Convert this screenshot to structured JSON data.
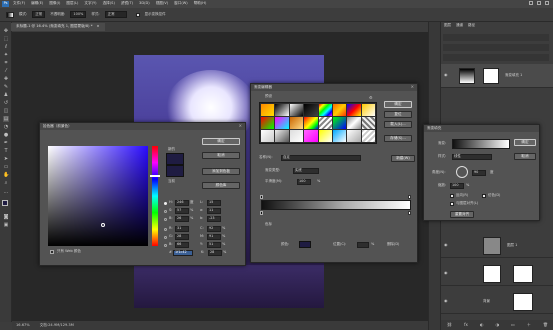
{
  "menu": {
    "items": [
      "文件(F)",
      "编辑(E)",
      "图像(I)",
      "图层(L)",
      "文字(Y)",
      "选择(S)",
      "滤镜(T)",
      "3D(D)",
      "视图(V)",
      "窗口(W)",
      "帮助(H)"
    ]
  },
  "options": {
    "mode_label": "模式:",
    "mode_value": "正常",
    "opacity_label": "不透明度:",
    "opacity_value": "100%",
    "style_label": "样式:",
    "style_value": "正常",
    "blend_label": "模式:",
    "checkbox_label": "显示变换控件"
  },
  "document": {
    "tab": "未标题-1 @ 16.4% (渐变填充 1, 图层蒙版/8) *"
  },
  "status": {
    "zoom": "16.67%",
    "doc": "文档:24.9M/129.3M"
  },
  "color_picker": {
    "title": "拾色器（前景色）",
    "ok": "确定",
    "cancel": "取消",
    "add_swatch": "添加到色板",
    "libraries": "颜色库",
    "new_label": "新的",
    "current_label": "当前",
    "web_only": "只有 Web 颜色",
    "fields": [
      {
        "k": "H:",
        "v": "246",
        "u": "度",
        "k2": "L:",
        "v2": "15"
      },
      {
        "k": "S:",
        "v": "57",
        "u": "%",
        "k2": "a:",
        "v2": "11"
      },
      {
        "k": "B:",
        "v": "26",
        "u": "%",
        "k2": "b:",
        "v2": "-23"
      },
      {
        "k": "R:",
        "v": "31",
        "u": "",
        "k2": "C:",
        "v2": "92"
      },
      {
        "k": "G:",
        "v": "28",
        "u": "",
        "k2": "M:",
        "v2": "91"
      },
      {
        "k": "B:",
        "v": "66",
        "u": "",
        "k2": "Y:",
        "v2": "51"
      },
      {
        "k": "",
        "v": "",
        "u": "",
        "k2": "K:",
        "v2": "28"
      }
    ],
    "cmyk_unit": "%",
    "hex": "1f1c42",
    "hex_prefix": "#",
    "new_color": "#1f1c42",
    "current_color": "#1f1c42"
  },
  "gradient_editor": {
    "title": "渐变编辑器",
    "presets_label": "预设",
    "ok": "确定",
    "reset": "复位",
    "load": "载入(L)...",
    "save": "存储(S)...",
    "new": "新建(W)",
    "name_label": "名称(N):",
    "name_value": "自定",
    "type_label": "渐变类型:",
    "type_value": "实底",
    "smooth_label": "平滑度(M):",
    "smooth_value": "100",
    "smooth_unit": "%",
    "stops_label": "色标",
    "color_label": "颜色:",
    "location_label": "位置(C):",
    "location_unit": "%",
    "delete_label": "删除(D)"
  },
  "gradient_fill": {
    "title": "渐变填充",
    "gradient_label": "渐变:",
    "style_label": "样式:",
    "style_value": "线性",
    "angle_label": "角度(N):",
    "angle_value": "90",
    "angle_unit": "度",
    "scale_label": "缩放:",
    "scale_value": "100",
    "scale_unit": "%",
    "reverse": "反向(R)",
    "dither": "仿色(D)",
    "align": "与图层对齐(L)",
    "reset_align": "重置对齐",
    "ok": "确定",
    "cancel": "取消"
  },
  "layers": {
    "tabs": [
      "图层",
      "通道",
      "路径"
    ],
    "names": [
      "渐变填充 1",
      "图层 1",
      "背景"
    ]
  },
  "colors": {
    "panel": "#535353",
    "accent": "#1f1c42"
  }
}
